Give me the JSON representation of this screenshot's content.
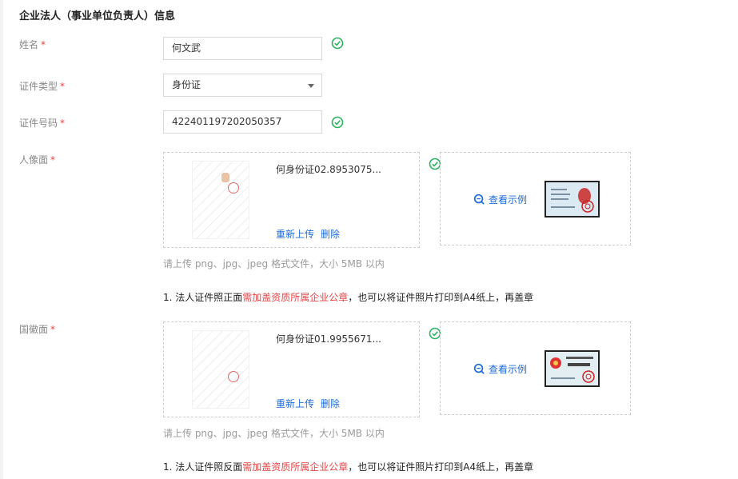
{
  "section_title": "企业法人（事业单位负责人）信息",
  "required_mark": "*",
  "fields": {
    "name": {
      "label": "姓名",
      "value": "何文武"
    },
    "id_type": {
      "label": "证件类型",
      "value": "身份证"
    },
    "id_number": {
      "label": "证件号码",
      "value": "422401197202050357"
    }
  },
  "portrait_side": {
    "label": "人像面",
    "file_name": "何身份证02.8953075...",
    "reupload": "重新上传",
    "delete": "删除",
    "example": "查看示例",
    "hint": "请上传 png、jpg、jpeg 格式文件，大小 5MB 以内",
    "note_prefix": "1. 法人证件照正面",
    "note_red": "需加盖资质所属企业公章",
    "note_suffix": "，也可以将证件照片打印到A4纸上，再盖章"
  },
  "emblem_side": {
    "label": "国徽面",
    "file_name": "何身份证01.9955671...",
    "reupload": "重新上传",
    "delete": "删除",
    "example": "查看示例",
    "hint": "请上传 png、jpg、jpeg 格式文件，大小 5MB 以内",
    "note_prefix": "1. 法人证件照反面",
    "note_red": "需加盖资质所属企业公章",
    "note_suffix": "，也可以将证件照片打印到A4纸上，再盖章"
  },
  "colors": {
    "accent": "#1e6bd6",
    "success": "#2bb25e",
    "required": "#e54545"
  }
}
